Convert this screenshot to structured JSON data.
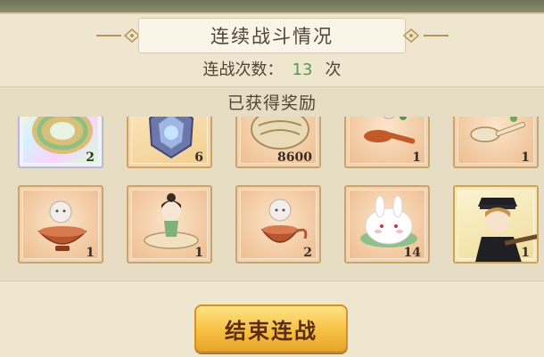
{
  "title": "连续战斗情况",
  "battle_count": {
    "label": "连战次数：",
    "value": "13",
    "unit": "次"
  },
  "rewards": {
    "header": "已获得奖励",
    "row1": [
      {
        "icon": "jade-donut-icon",
        "qty": "2",
        "style": "rare"
      },
      {
        "icon": "crystal-gem-icon",
        "qty": "6",
        "style": "gold"
      },
      {
        "icon": "seed-pouch-icon",
        "qty": "8600",
        "style": "normal"
      },
      {
        "icon": "spoon-spirit-icon",
        "qty": "1",
        "style": "normal"
      },
      {
        "icon": "ladle-spirit-icon",
        "qty": "1",
        "style": "normal"
      }
    ],
    "row2": [
      {
        "icon": "bowl-spirit-icon",
        "qty": "1",
        "style": "normal"
      },
      {
        "icon": "dish-girl-icon",
        "qty": "1",
        "style": "normal"
      },
      {
        "icon": "teapot-spirit-icon",
        "qty": "2",
        "style": "normal"
      },
      {
        "icon": "rabbit-bun-icon",
        "qty": "14",
        "style": "normal"
      },
      {
        "icon": "officer-character-icon",
        "qty": "1",
        "style": "char"
      }
    ]
  },
  "end_button": "结束连战"
}
